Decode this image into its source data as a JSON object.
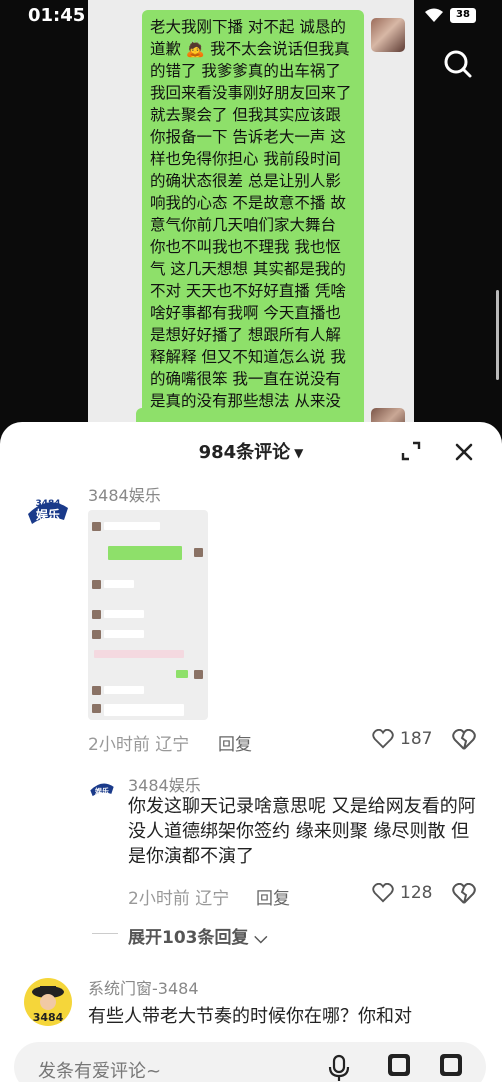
{
  "status": {
    "time": "01:45",
    "battery": "38"
  },
  "chat": {
    "message": "老大我刚下播 对不起 诚恳的道歉 🙇 我不太会说话但我真的错了 我爹爹真的出车祸了 我回来看没事刚好朋友回来了就去聚会了 但我其实应该跟你报备一下 告诉老大一声 这样也免得你担心 我前段时间的确状态很差 总是让别人影响我的心态 不是故意不播 故意气你前几天咱们家大舞台 你也不叫我也不理我 我也怄气 这几天想想 其实都是我的不对 天天也不好好直播 凭啥啥好事都有我啊 今天直播也是想好好播了 想跟所有人解释解释 但又不知道怎么说 我的确嘴很笨 我一直在说没有是真的没有那些想法 从来没想过背叛你 我这几天朋友回来劝导我 开解我 我是真的想好好播了 别生我气了 我保证这次不伤你心 不会再有这么不懂事的时候了 老大 对不起 原谅妹妹一次"
  },
  "sheet": {
    "title": "984条评论",
    "comments": [
      {
        "user": "3484娱乐",
        "time": "2小时前",
        "location": "辽宁",
        "reply_label": "回复",
        "likes": "187"
      },
      {
        "user": "3484娱乐",
        "text": "你发这聊天记录啥意思呢 又是给网友看的阿 没人道德绑架你签约 缘来则聚 缘尽则散 但是你演都不演了",
        "time": "2小时前",
        "location": "辽宁",
        "reply_label": "回复",
        "likes": "128"
      },
      {
        "user": "系统门窗-3484",
        "text": "有些人带老大节奏的时候你在哪？你和对"
      }
    ],
    "expand_replies": "展开103条回复",
    "input_placeholder": "发条有爱评论~"
  },
  "icons": {
    "search": "search-icon",
    "expand": "expand-icon",
    "close": "close-icon",
    "heart": "heart-icon",
    "dislike": "broken-heart-icon",
    "mic": "microphone-icon"
  }
}
